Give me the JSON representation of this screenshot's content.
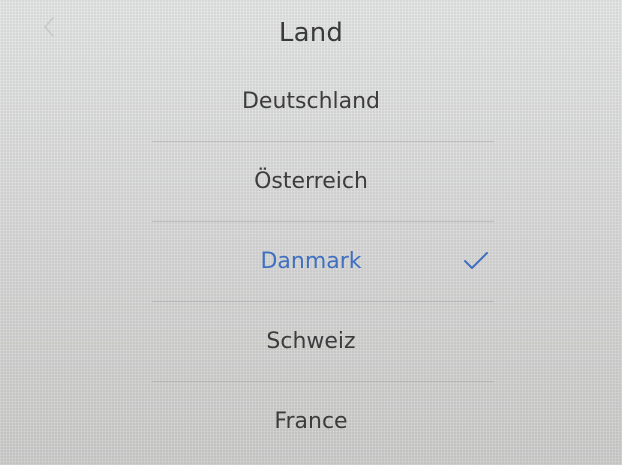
{
  "header": {
    "title": "Land",
    "back_icon": "chevron-left-icon"
  },
  "countries": {
    "items": [
      {
        "label": "Deutschland",
        "selected": false
      },
      {
        "label": "Österreich",
        "selected": false
      },
      {
        "label": "Danmark",
        "selected": true
      },
      {
        "label": "Schweiz",
        "selected": false
      },
      {
        "label": "France",
        "selected": false
      }
    ],
    "selected_icon": "checkmark-icon"
  },
  "colors": {
    "selected_text": "#3f6fc0",
    "default_text": "#3c3c3c",
    "background": "#dcdddc"
  }
}
